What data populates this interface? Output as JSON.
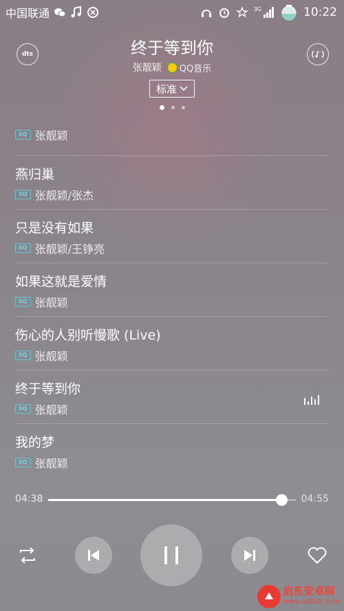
{
  "status_bar": {
    "carrier": "中国联通",
    "network_label": "3G",
    "time": "10:22",
    "icons": [
      "wechat-icon",
      "music-note-icon",
      "sync-icon",
      "headphones-icon",
      "alarm-icon",
      "star-icon",
      "signal-icon",
      "battery-icon"
    ]
  },
  "header": {
    "title": "终于等到你",
    "artist": "张靓颖",
    "source": "QQ音乐",
    "left_button_label": "dts",
    "quality_label": "标准",
    "page_dots": 3,
    "active_dot": 0
  },
  "playlist": {
    "partial_artist": "张靓颖",
    "items": [
      {
        "title": "燕归巢",
        "artist": "张靓颖/张杰",
        "badge": "SQ"
      },
      {
        "title": "只是没有如果",
        "artist": "张靓颖/王铮亮",
        "badge": "SQ"
      },
      {
        "title": "如果这就是爱情",
        "artist": "张靓颖",
        "badge": "SQ"
      },
      {
        "title": "伤心的人别听慢歌 (Live)",
        "artist": "张靓颖",
        "badge": "SQ"
      },
      {
        "title": "终于等到你",
        "artist": "张靓颖",
        "badge": "SQ",
        "playing": true
      },
      {
        "title": "我的梦",
        "artist": "张靓颖",
        "badge": "SQ"
      }
    ],
    "partial_badge": "SQ"
  },
  "player": {
    "current_time": "04:38",
    "total_time": "04:55",
    "progress": 0.942
  },
  "watermark": {
    "name": "启东安卓网",
    "url": "www.qdltdz.com"
  },
  "colors": {
    "accent_sq": "#6fd6e4",
    "watermark_red": "#e83a33"
  }
}
